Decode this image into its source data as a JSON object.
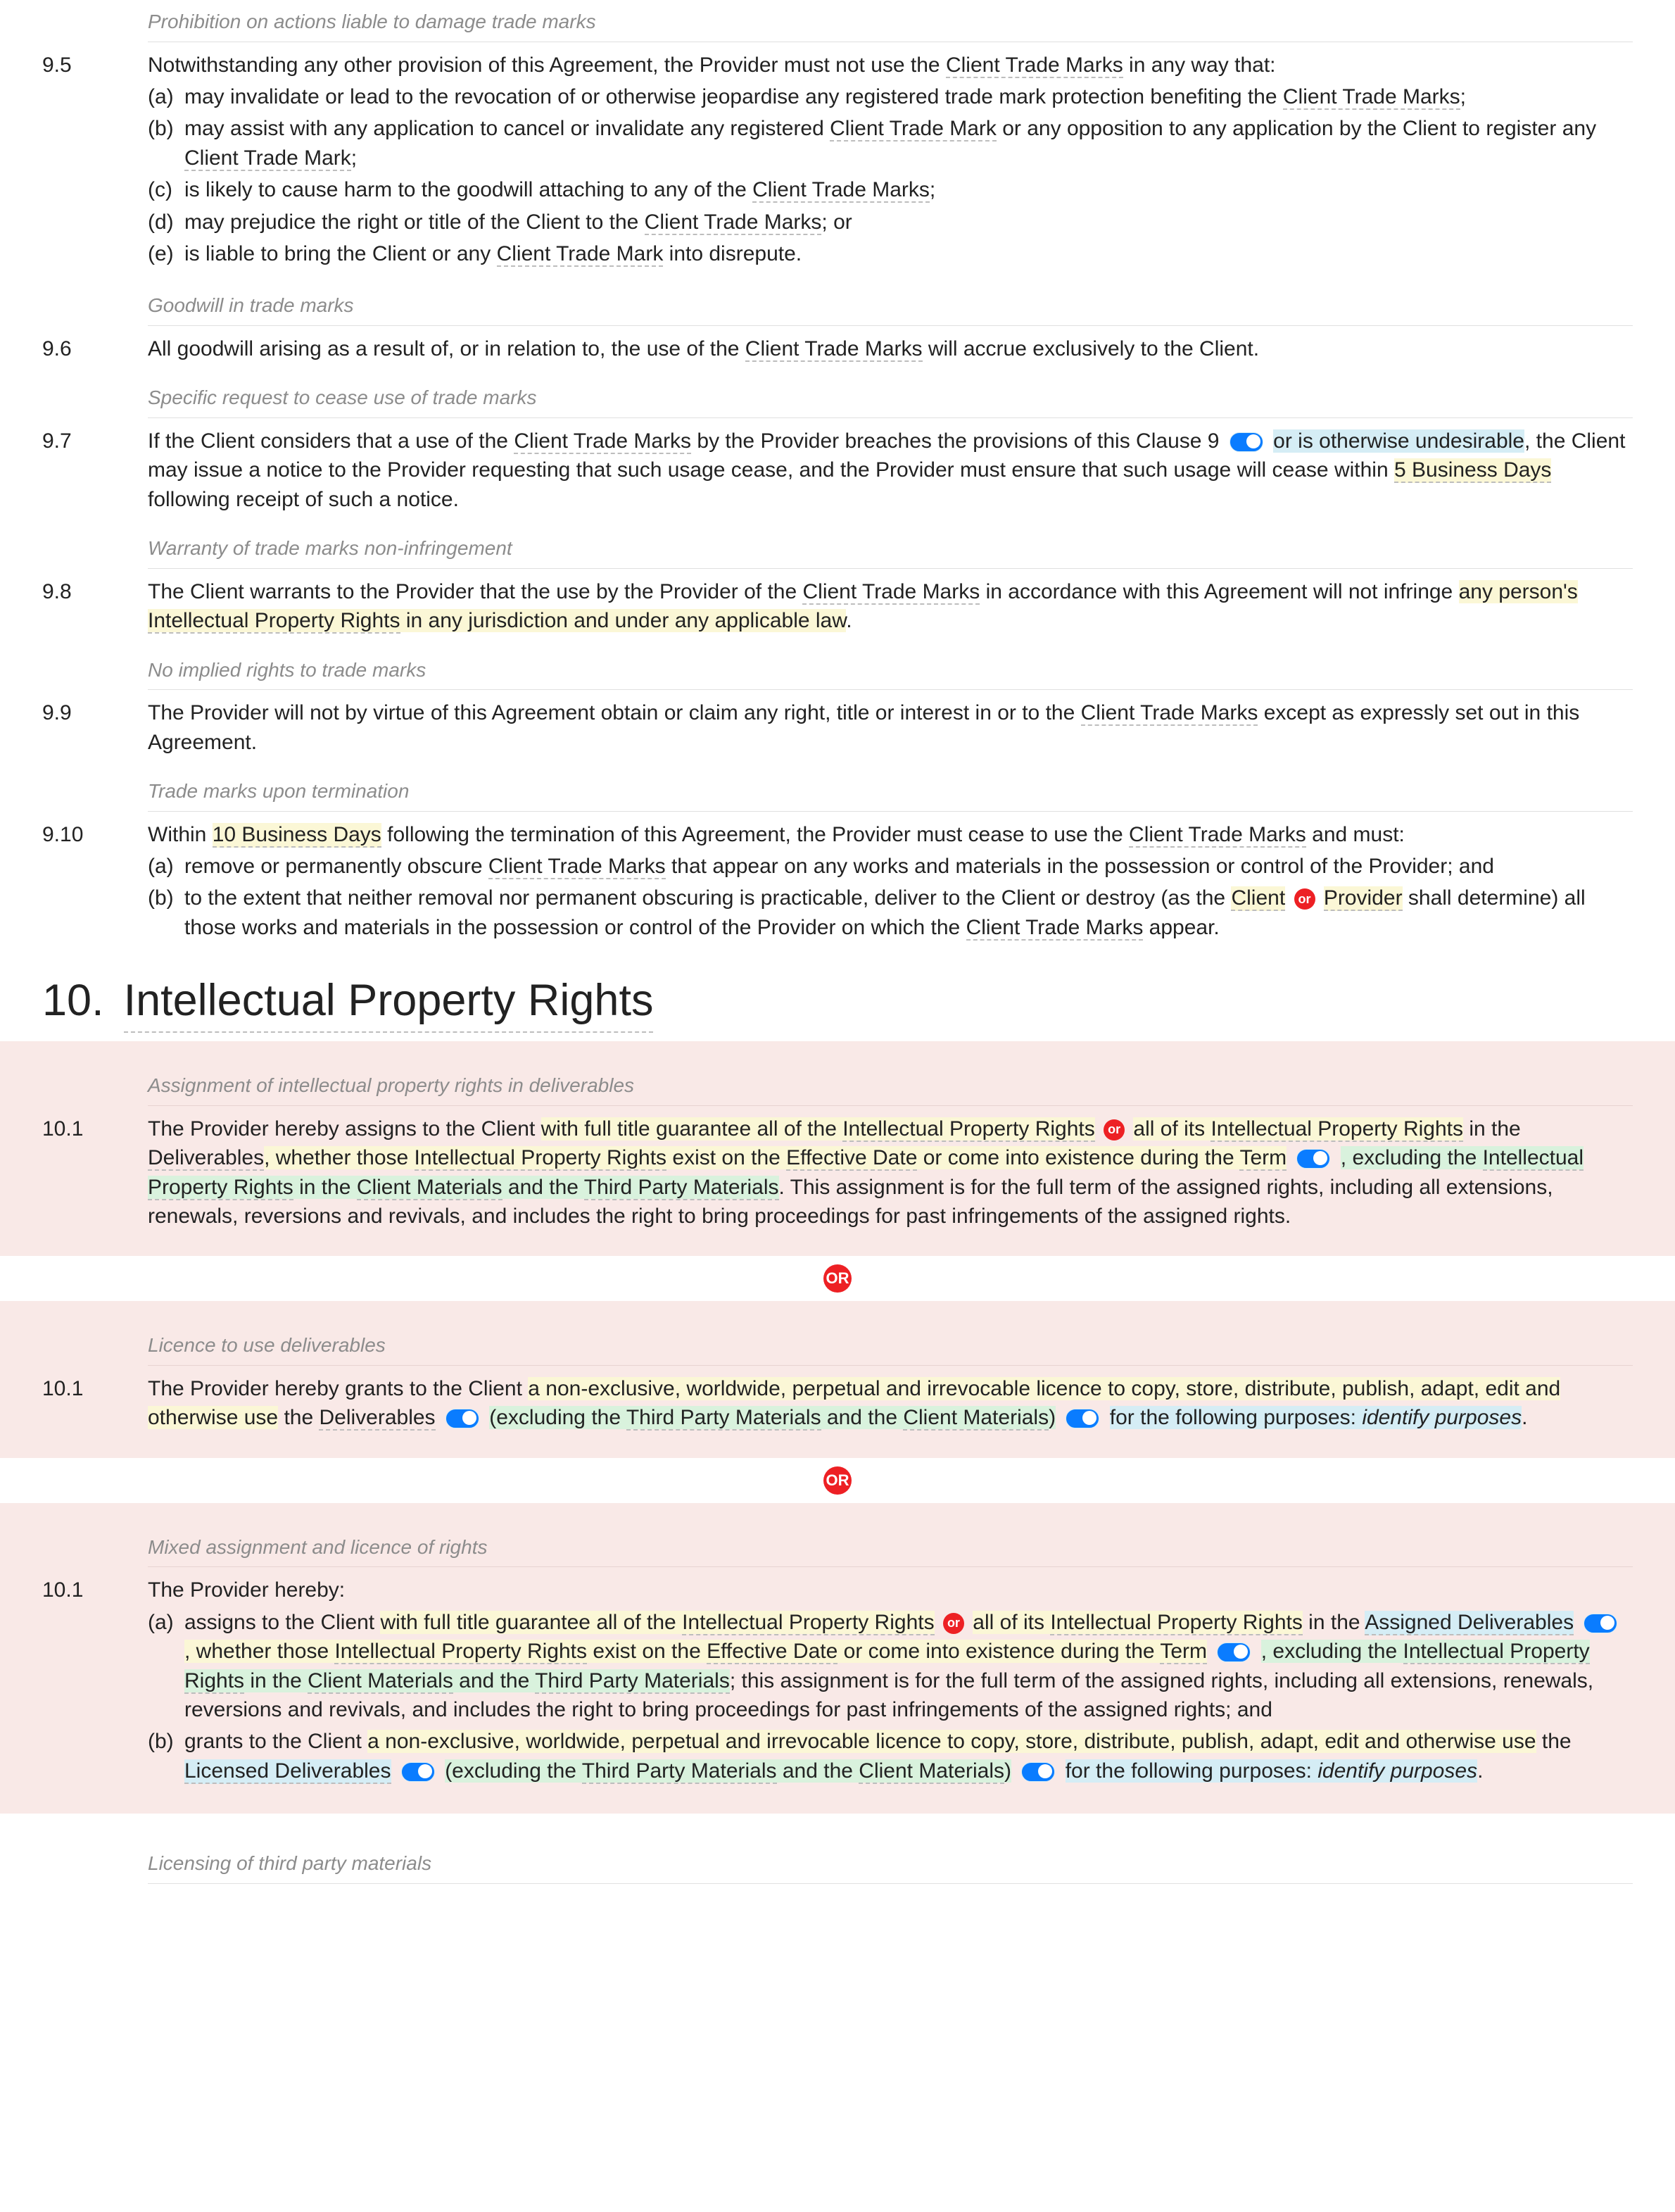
{
  "c95": {
    "cap": "Prohibition on actions liable to damage trade marks",
    "num": "9.5",
    "lead": "Notwithstanding any other provision of this Agreement, the Provider must not use the ",
    "term": "Client Trade Marks",
    "lead2": " in any way that:",
    "a1": "may invalidate or lead to the revocation of or otherwise jeopardise any registered trade mark protection benefiting the ",
    "a1t": "Client Trade Marks",
    "a1e": ";",
    "b1": "may assist with any application to cancel or invalidate any registered ",
    "b1t": "Client Trade Mark",
    "b2": " or any opposition to any application by the Client to register any ",
    "b2t": "Client Trade Mark",
    "b2e": ";",
    "c1": "is likely to cause harm to the goodwill attaching to any of the ",
    "c1t": "Client Trade Marks",
    "c1e": ";",
    "d1": "may prejudice the right or title of the Client to the ",
    "d1t": "Client Trade Marks",
    "d1e": "; or",
    "e1": "is liable to bring the Client or any ",
    "e1t": "Client Trade Mark",
    "e1e": " into disrepute."
  },
  "c96": {
    "cap": "Goodwill in trade marks",
    "num": "9.6",
    "t1": "All goodwill arising as a result of, or in relation to, the use of the ",
    "term": "Client Trade Marks",
    "t2": " will accrue exclusively to the Client."
  },
  "c97": {
    "cap": "Specific request to cease use of trade marks",
    "num": "9.7",
    "t1": "If the Client considers that a use of the ",
    "term": "Client Trade Marks",
    "t2": " by the Provider breaches the provisions of this Clause 9 ",
    "hb": "or is otherwise undesirable",
    "t3": ", the Client may issue a notice to the Provider requesting that such usage cease, and the Provider must ensure that such usage will cease within ",
    "bd": "5 Business Days",
    "t4": " following receipt of such a notice."
  },
  "c98": {
    "cap": "Warranty of trade marks non-infringement",
    "num": "9.8",
    "t1": "The Client warrants to the Provider that the use by the Provider of the ",
    "term": "Client Trade Marks",
    "t2": " in accordance with this Agreement will not infringe ",
    "hy": "any person's ",
    "ipr": "Intellectual Property Rights",
    "hy2": " in any jurisdiction and under any applicable law",
    "t3": "."
  },
  "c99": {
    "cap": "No implied rights to trade marks",
    "num": "9.9",
    "t1": "The Provider will not by virtue of this Agreement obtain or claim any right, title or interest in or to the ",
    "term": "Client Trade Marks",
    "t2": " except as expressly set out in this Agreement."
  },
  "c910": {
    "cap": "Trade marks upon termination",
    "num": "9.10",
    "t1": "Within ",
    "bd": "10 Business Days",
    "t2": " following the termination of this Agreement, the Provider must cease to use the ",
    "term": "Client Trade Marks",
    "t3": " and must:",
    "a1": "remove or permanently obscure ",
    "a1t": "Client Trade Marks",
    "a2": " that appear on any works and materials in the possession or control of the Provider; and",
    "b1": "to the extent that neither removal nor permanent obscuring is practicable, deliver to the Client or destroy (as the ",
    "bc": "Client",
    "or": "or",
    "bp": "Provider",
    "b2": " shall determine) all those works and materials in the possession or control of the Provider on which the ",
    "b2t": "Client Trade Marks",
    "b3": " appear."
  },
  "s10": {
    "num": "10.",
    "title": "Intellectual Property Rights"
  },
  "c101a": {
    "cap": "Assignment of intellectual property rights in deliverables",
    "num": "10.1",
    "t1": "The Provider hereby assigns to the Client ",
    "y1": "with full title guarantee all of the ",
    "ipr1": "Intellectual Property Rights",
    "or": "or",
    "y2": "all of its ",
    "ipr2": "Intellectual Property Rights",
    "t2": " in the ",
    "del": "Deliverables",
    "y3": ", whether those ",
    "ipr3": "Intellectual Property Rights",
    "y4": " exist on the ",
    "ed": "Effective Date",
    "y5": " or come into existence during the ",
    "trm": "Term",
    "g1": ", excluding the ",
    "ipr4": "Intellectual Property Rights",
    "g2": " in the ",
    "cm": "Client Materials",
    "g3": " and the ",
    "tpm": "Third Party Materials",
    "t3": ". This assignment is for the full term of the assigned rights, including all extensions, renewals, reversions and revivals, and includes the right to bring proceedings for past infringements of the assigned rights."
  },
  "orbig": "OR",
  "c101b": {
    "cap": "Licence to use deliverables",
    "num": "10.1",
    "t1": "The Provider hereby grants to the Client ",
    "y1": "a non-exclusive, worldwide, perpetual and irrevocable licence to copy, store, distribute, publish, adapt, edit and otherwise use",
    "t2": " the ",
    "del": "Deliverables",
    "g1": "(excluding the ",
    "tpm": "Third Party Materials",
    "g2": " and the ",
    "cm": "Client Materials",
    "g3": ")",
    "t3": " for the following purposes: ",
    "idp": "identify purposes",
    "t4": "."
  },
  "c101c": {
    "cap": "Mixed assignment and licence of rights",
    "num": "10.1",
    "lead": "The Provider hereby:",
    "a1": "assigns to the Client ",
    "ay1": "with full title guarantee all of the ",
    "ipr1": "Intellectual Property Rights",
    "or": "or",
    "ay2": "all of its ",
    "ipr2": "Intellectual Property Rights",
    "a2": " in the ",
    "ad": "Assigned Deliverables",
    "ay3": ", whether those ",
    "ipr3": "Intellectual Property Rights",
    "ay4": " exist on the ",
    "ed": "Effective Date",
    "ay5": " or come into existence during the ",
    "trm": "Term",
    "ag1": ", excluding the ",
    "ipr4": "Intellectual Property Rights",
    "ag2": " in the ",
    "cm": "Client Materials",
    "ag3": " and the ",
    "tpm": "Third Party Materials",
    "a3": "; this assignment is for the full term of the assigned rights, including all extensions, renewals, reversions and revivals, and includes the right to bring proceedings for past infringements of the assigned rights; and",
    "b1": "grants to the Client ",
    "by1": "a non-exclusive, worldwide, perpetual and irrevocable licence to copy, store, distribute, publish, adapt, edit and otherwise use",
    "b2": " the ",
    "ld": "Licensed Deliverables",
    "bg1": "(excluding the ",
    "tpm2": "Third Party Materials",
    "bg2": " and the ",
    "cm2": "Client Materials",
    "bg3": ")",
    "b3": " for the following purposes: ",
    "idp": "identify purposes",
    "b4": "."
  },
  "c102": {
    "cap": "Licensing of third party materials"
  }
}
